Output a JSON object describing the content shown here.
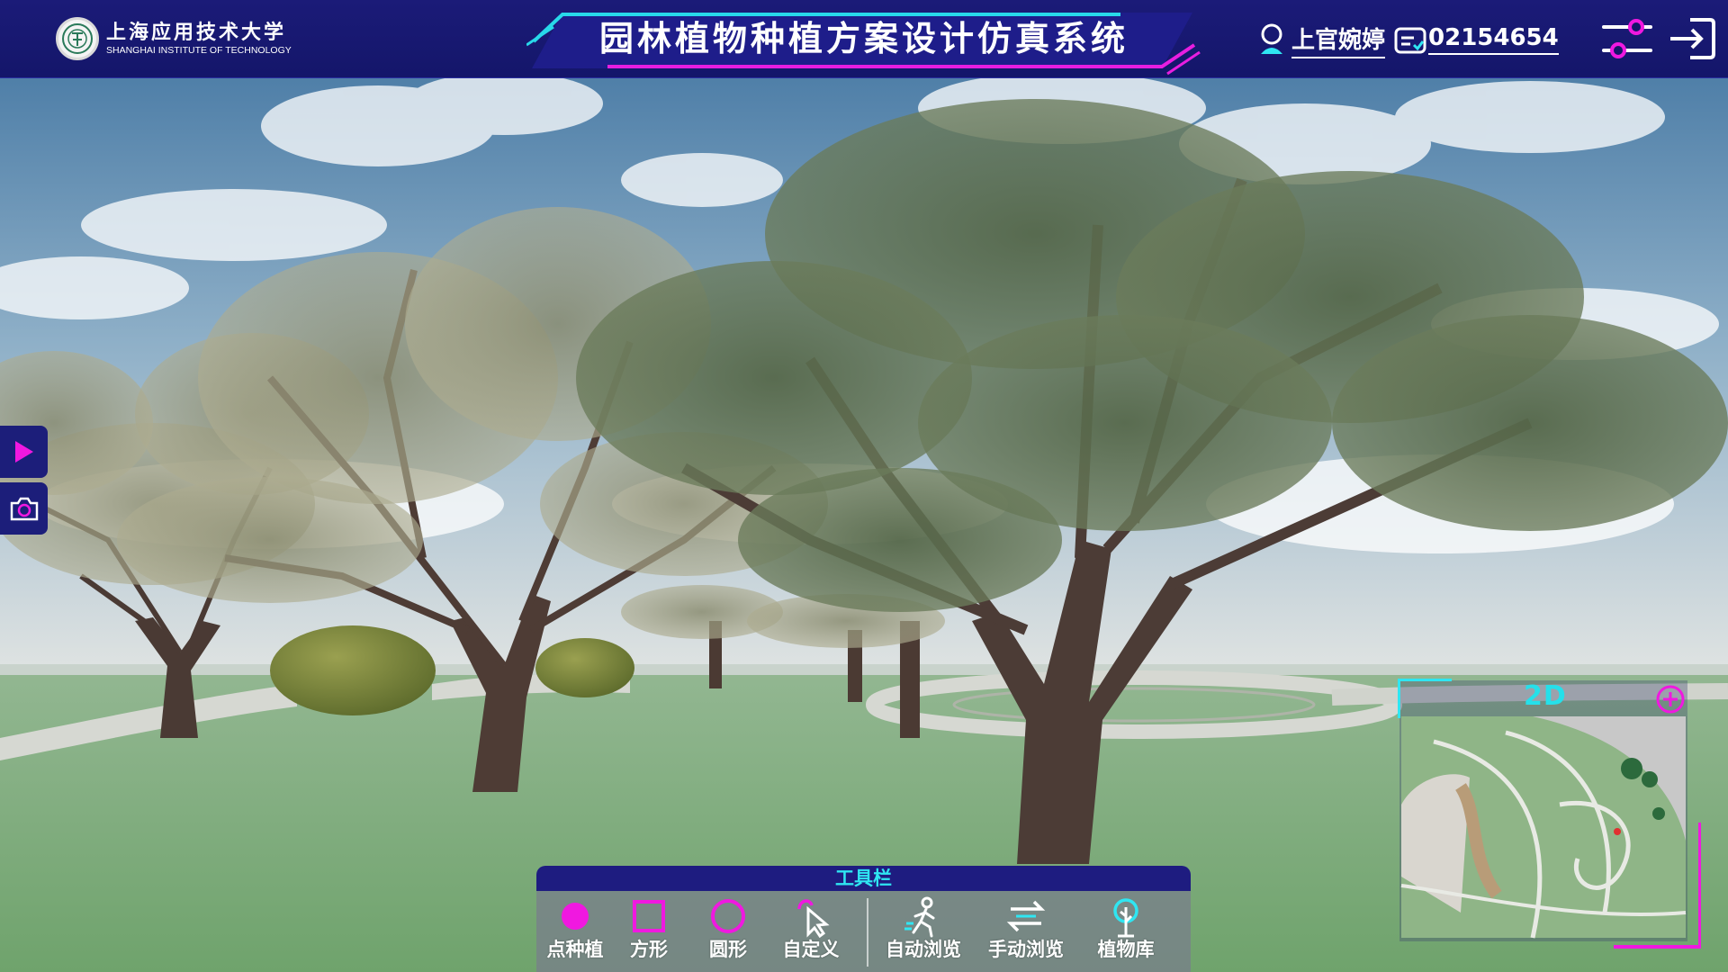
{
  "header": {
    "logo_cn": "上海应用技术大学",
    "logo_en": "SHANGHAI INSTITUTE OF TECHNOLOGY",
    "title": "园林植物种植方案设计仿真系统",
    "user_name": "上官婉婷",
    "user_id": "02154654"
  },
  "minimap": {
    "mode_label": "2D"
  },
  "toolbar": {
    "title": "工具栏",
    "tools": [
      {
        "label": "点种植",
        "icon": "dot-plant-icon"
      },
      {
        "label": "方形",
        "icon": "square-icon"
      },
      {
        "label": "圆形",
        "icon": "circle-icon"
      },
      {
        "label": "自定义",
        "icon": "custom-pointer-icon"
      },
      {
        "label": "自动浏览",
        "icon": "walking-person-icon"
      },
      {
        "label": "手动浏览",
        "icon": "swap-arrows-icon"
      },
      {
        "label": "植物库",
        "icon": "tree-icon"
      }
    ]
  },
  "colors": {
    "header_bg": "#14166a",
    "accent_cyan": "#25e0ea",
    "accent_magenta": "#f018e0",
    "grass": "#7fae7a"
  }
}
